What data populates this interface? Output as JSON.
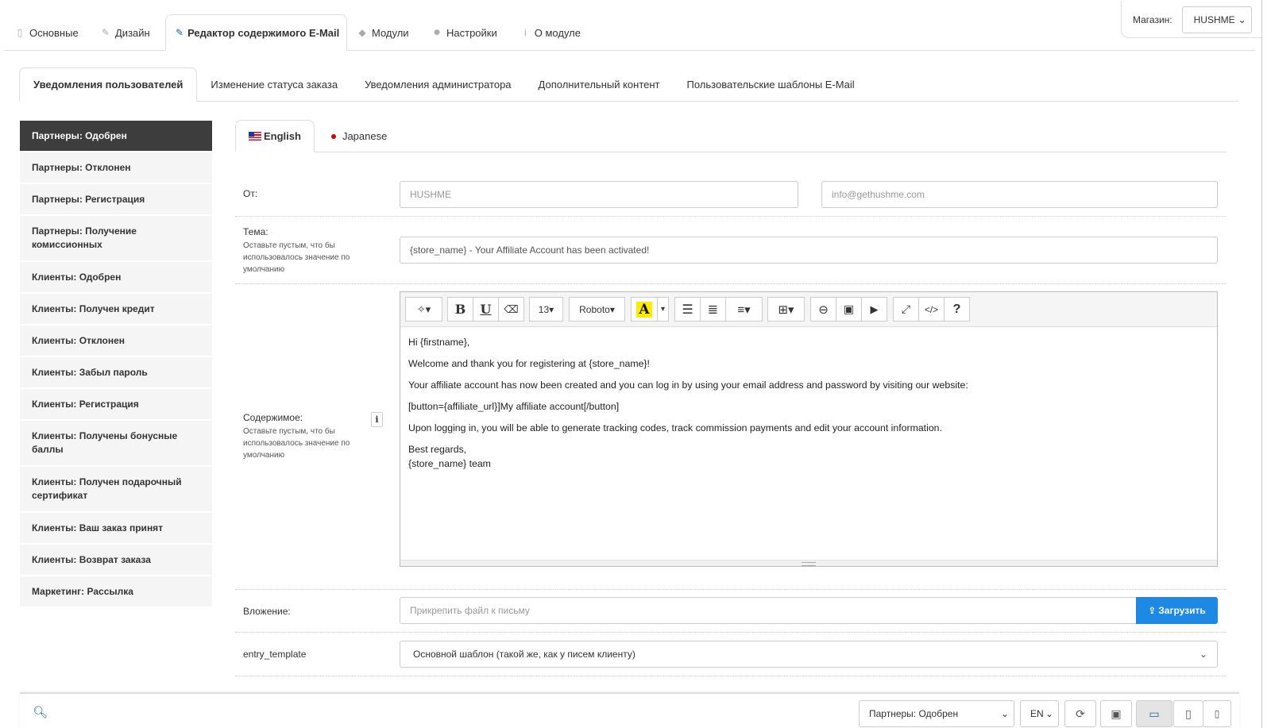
{
  "top_tabs": [
    {
      "label": "Основные",
      "icon": "file-icon",
      "glyph": "▯"
    },
    {
      "label": "Дизайн",
      "icon": "brush-icon",
      "glyph": "✎"
    },
    {
      "label": "Редактор содержимого E-Mail",
      "icon": "pencil-icon",
      "glyph": "✎",
      "active": true
    },
    {
      "label": "Модули",
      "icon": "cube-icon",
      "glyph": "◆"
    },
    {
      "label": "Настройки",
      "icon": "gear-icon",
      "glyph": "✹"
    },
    {
      "label": "О модуле",
      "icon": "info-icon",
      "glyph": "i"
    }
  ],
  "store": {
    "label": "Магазин:",
    "value": "HUSHME"
  },
  "sub_tabs": [
    {
      "label": "Уведомления пользователей",
      "active": true
    },
    {
      "label": "Изменение статуса заказа"
    },
    {
      "label": "Уведомления администратора"
    },
    {
      "label": "Дополнительный контент"
    },
    {
      "label": "Пользовательские шаблоны E-Mail"
    }
  ],
  "left_nav": [
    {
      "label": "Партнеры: Одобрен",
      "active": true
    },
    {
      "label": "Партнеры: Отклонен"
    },
    {
      "label": "Партнеры: Регистрация"
    },
    {
      "label": "Партнеры: Получение комиссионных"
    },
    {
      "label": "Клиенты: Одобрен"
    },
    {
      "label": "Клиенты: Получен кредит"
    },
    {
      "label": "Клиенты: Отклонен"
    },
    {
      "label": "Клиенты: Забыл пароль"
    },
    {
      "label": "Клиенты: Регистрация"
    },
    {
      "label": "Клиенты: Получены бонусные баллы"
    },
    {
      "label": "Клиенты: Получен подарочный сертификат"
    },
    {
      "label": "Клиенты: Ваш заказ принят"
    },
    {
      "label": "Клиенты: Возврат заказа"
    },
    {
      "label": "Маркетинг: Рассылка"
    }
  ],
  "lang_tabs": [
    {
      "label": "English",
      "flag": "us",
      "active": true
    },
    {
      "label": "Japanese",
      "flag": "jp"
    }
  ],
  "form": {
    "from_label": "От:",
    "from_name_placeholder": "HUSHME",
    "from_email_placeholder": "info@gethushme.com",
    "subject_label": "Тема:",
    "subject_hint": "Оставьте пустым, что бы использовалось значение по умолчанию",
    "subject_value": "{store_name} - Your Affiliate Account has been activated!",
    "content_label": "Содержимое:",
    "content_hint": "Оставьте пустым, что бы использовалось значение по умолчанию",
    "info_glyph": "i",
    "attachment_label": "Вложение:",
    "attachment_placeholder": "Прикрепить файл к письму",
    "upload_label": "Загрузить",
    "template_label": "entry_template",
    "template_value": "Основной шаблон (такой же, как у писем клиенту)"
  },
  "toolbar": {
    "font_size": "13",
    "font_name": "Roboto",
    "bold": "B",
    "underline": "U",
    "color_glyph": "A",
    "help": "?",
    "code": "</>"
  },
  "editor": {
    "lines": [
      "Hi {firstname},",
      "Welcome and thank you for registering at {store_name}!",
      "Your affiliate account has now been created and you can log in by using your email address and password by visiting our website:",
      "[button={affiliate_url}]My affiliate account[/button]",
      "Upon logging in, you will be able to generate tracking codes, track commission payments and edit your account information."
    ],
    "closing_1": "Best regards,",
    "closing_2": "{store_name} team"
  },
  "bottom_bar": {
    "preview_select": "Партнеры: Одобрен",
    "lang_select": "EN"
  },
  "colors": {
    "accent": "#1e88e5",
    "nav_active": "#3d3d3d"
  }
}
